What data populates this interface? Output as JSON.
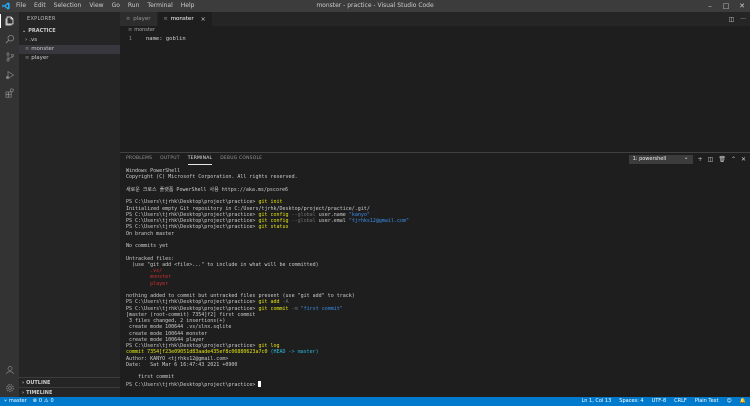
{
  "window": {
    "title": "monster - practice - Visual Studio Code",
    "menu": [
      "File",
      "Edit",
      "Selection",
      "View",
      "Go",
      "Run",
      "Terminal",
      "Help"
    ]
  },
  "sidebar": {
    "title": "EXPLORER",
    "section": "PRACTICE",
    "items": [
      {
        "label": ".vs",
        "type": "folder"
      },
      {
        "label": "monster",
        "type": "file"
      },
      {
        "label": "player",
        "type": "file"
      }
    ],
    "outline": "OUTLINE",
    "timeline": "TIMELINE"
  },
  "editor": {
    "tabs": [
      {
        "label": "player",
        "active": false
      },
      {
        "label": "monster",
        "active": true
      }
    ],
    "breadcrumb": "monster",
    "lines": [
      {
        "no": "1",
        "text": "name: goblin"
      }
    ]
  },
  "panel": {
    "tabs": [
      "PROBLEMS",
      "OUTPUT",
      "TERMINAL",
      "DEBUG CONSOLE"
    ],
    "active_tab": "TERMINAL",
    "terminal_select": "1: powershell",
    "prompt": "PS C:\\Users\\tjrhk\\Desktop\\project\\practice>",
    "lines": {
      "l1": "Windows PowerShell",
      "l2": "Copyright (C) Microsoft Corporation. All rights reserved.",
      "l3": "새로운 크로스 플랫폼 PowerShell 사용 https://aka.ms/pscore6",
      "cmd_init": "git init",
      "init_out": "Initialized empty Git repository in C:/Users/tjrhk/Desktop/project/practice/.git/",
      "cmd_config": "git config",
      "flag_global": "--global",
      "cfg_name_key": "user.name",
      "cfg_name_val": "\"kanyo\"",
      "cfg_email_key": "user.emal",
      "cfg_email_val": "\"tjrhks12@gmail.com\"",
      "cmd_status": "git status",
      "on_branch": "On branch master",
      "no_commits": "No commits yet",
      "untracked": "Untracked files:",
      "use_add": "  (use \"git add <file>...\" to include in what will be committed)",
      "u1": "        .vs/",
      "u2": "        monster",
      "u3": "        player",
      "nothing": "nothing added to commit but untracked files present (use \"git add\" to track)",
      "cmd_add": "git add",
      "flag_a": "-A",
      "cmd_commit": "git commit",
      "flag_m": "-m",
      "commit_msg": "\"first commit\"",
      "commit_out1": "[master (root-commit) 7354]f2] first commit",
      "commit_out2": " 3 files changed, 2 insertions(+)",
      "commit_out3": " create mode 100644 .vs/slnx.sqlite",
      "commit_out4": " create mode 100644 monster",
      "commit_out5": " create mode 100644 player",
      "cmd_log": "git log",
      "log_commit": "commit 7354]f23e09051d83aade435ef8c06880623a7c0",
      "log_head": "(HEAD -> master)",
      "log_author": "Author: KANYO <tjrhks12@gmail.com>",
      "log_date": "Date:   Sat Mar 6 16:47:43 2021 +0900",
      "log_msg": "    first commit"
    }
  },
  "statusbar": {
    "branch": "master",
    "errors": "0",
    "warnings": "0",
    "position": "Ln 1, Col 13",
    "spaces": "Spaces: 4",
    "encoding": "UTF-8",
    "eol": "CRLF",
    "language": "Plain Text"
  },
  "colors": {
    "accent": "#007acc",
    "titlebar": "#3c3c3c",
    "activitybar": "#333333",
    "sidebar": "#252526",
    "editor": "#1e1e1e"
  }
}
